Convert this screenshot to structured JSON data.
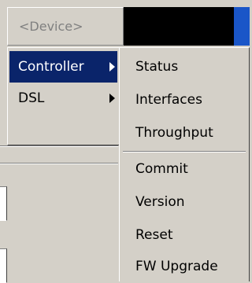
{
  "device_header": {
    "label": "<Device>"
  },
  "menu": {
    "items": [
      {
        "label": "Controller",
        "has_submenu": true,
        "selected": true
      },
      {
        "label": "DSL",
        "has_submenu": true,
        "selected": false
      }
    ]
  },
  "submenu": {
    "group1": [
      {
        "label": "Status"
      },
      {
        "label": "Interfaces"
      },
      {
        "label": "Throughput"
      }
    ],
    "group2": [
      {
        "label": "Commit"
      },
      {
        "label": "Version"
      },
      {
        "label": "Reset"
      },
      {
        "label": "FW Upgrade"
      }
    ]
  },
  "colors": {
    "menu_background": "#d4d0c8",
    "selection_background": "#0a246a",
    "selection_text": "#ffffff",
    "disabled_text": "#808080",
    "header_dark": "#000000",
    "header_accent": "#1a56c8"
  }
}
